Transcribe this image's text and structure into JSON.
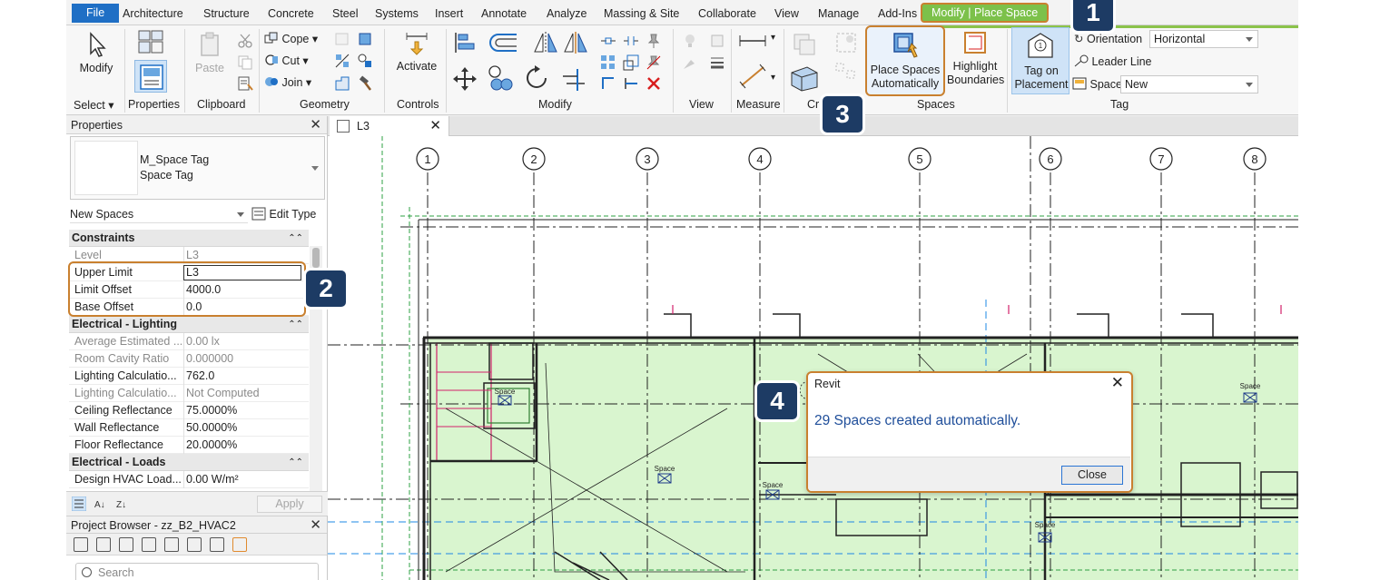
{
  "menu": {
    "tabs": [
      "File",
      "Architecture",
      "Structure",
      "Concrete",
      "Steel",
      "Systems",
      "Insert",
      "Annotate",
      "Analyze",
      "Massing & Site",
      "Collaborate",
      "View",
      "Manage",
      "Add-Ins"
    ],
    "context_tab": "Modify | Place Space"
  },
  "ribbon": {
    "select": {
      "modify": "Modify",
      "select_label": "Select ▾"
    },
    "properties_label": "Properties",
    "clipboard": {
      "paste": "Paste",
      "label": "Clipboard"
    },
    "geometry": {
      "cope": "Cope",
      "cut": "Cut",
      "join": "Join",
      "label": "Geometry"
    },
    "controls": {
      "activate": "Activate",
      "label": "Controls"
    },
    "modify_label": "Modify",
    "view_label": "View",
    "measure_label": "Measure",
    "create_label": "Cr",
    "spaces": {
      "place_auto_line1": "Place Spaces",
      "place_auto_line2": "Automatically",
      "highlight_line1": "Highlight",
      "highlight_line2": "Boundaries",
      "label": "Spaces"
    },
    "tag": {
      "tag_line1": "Tag on",
      "tag_line2": "Placement",
      "orientation_label": "Orientation",
      "orientation_value": "Horizontal",
      "leader_line": "Leader Line",
      "space_label": "Space",
      "space_value": "New",
      "label": "Tag"
    }
  },
  "properties": {
    "title": "Properties",
    "type_family": "M_Space Tag",
    "type_name": "Space Tag",
    "instance_filter": "New Spaces",
    "edit_type": "Edit Type",
    "groups": [
      {
        "name": "Constraints",
        "rows": [
          {
            "k": "Level",
            "v": "L3",
            "ro": true
          },
          {
            "k": "Upper Limit",
            "v": "L3",
            "edit": true
          },
          {
            "k": "Limit Offset",
            "v": "4000.0"
          },
          {
            "k": "Base Offset",
            "v": "0.0"
          }
        ]
      },
      {
        "name": "Electrical - Lighting",
        "rows": [
          {
            "k": "Average Estimated ...",
            "v": "0.00 lx",
            "ro": true
          },
          {
            "k": "Room Cavity Ratio",
            "v": "0.000000",
            "ro": true
          },
          {
            "k": "Lighting Calculatio...",
            "v": "762.0"
          },
          {
            "k": "Lighting Calculatio...",
            "v": "Not Computed",
            "ro": true
          },
          {
            "k": "Ceiling Reflectance",
            "v": "75.0000%"
          },
          {
            "k": "Wall Reflectance",
            "v": "50.0000%"
          },
          {
            "k": "Floor Reflectance",
            "v": "20.0000%"
          }
        ]
      },
      {
        "name": "Electrical - Loads",
        "rows": [
          {
            "k": "Design HVAC Load...",
            "v": "0.00 W/m²"
          }
        ]
      }
    ],
    "apply": "Apply"
  },
  "project_browser": {
    "title": "Project Browser - zz_B2_HVAC2",
    "search_placeholder": "Search"
  },
  "view": {
    "tab": "L3",
    "grid_labels": [
      "1",
      "2",
      "3",
      "4",
      "5",
      "6",
      "7",
      "8"
    ],
    "space_tag_text": "Space"
  },
  "dialog": {
    "title": "Revit",
    "message": "29 Spaces created automatically.",
    "close_button": "Close"
  },
  "callouts": [
    "1",
    "2",
    "3",
    "4"
  ],
  "colors": {
    "accent_orange": "#c9802f",
    "badge_navy": "#1d3b64",
    "space_fill": "#d9f5cf",
    "file_blue": "#1f6fc5",
    "context_green": "#7cc14a"
  }
}
